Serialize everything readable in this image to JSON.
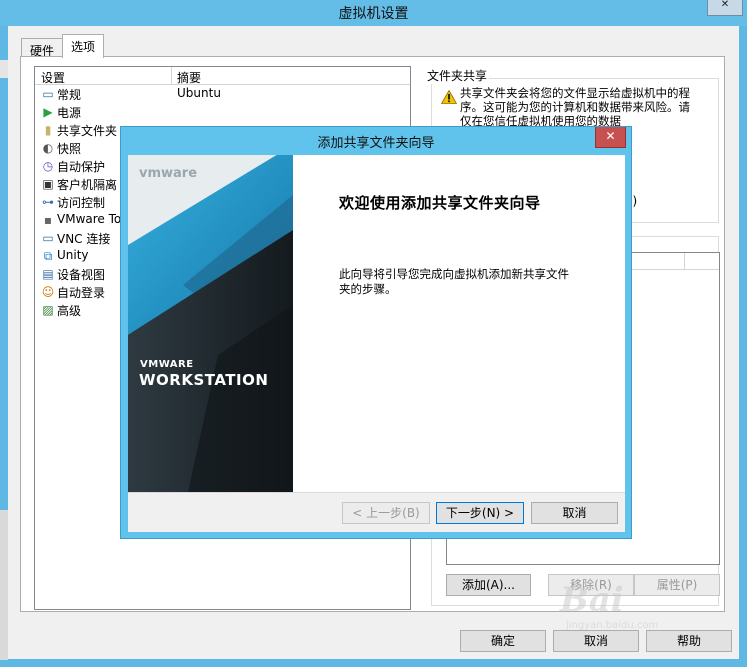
{
  "main_window": {
    "title": "虚拟机设置",
    "tabs": [
      {
        "label": "硬件",
        "selected": false
      },
      {
        "label": "选项",
        "selected": true
      }
    ],
    "settings_list": {
      "columns": [
        "设置",
        "摘要"
      ],
      "rows": [
        {
          "label": "常规",
          "summary": "Ubuntu",
          "icon": "monitor-icon"
        },
        {
          "label": "电源",
          "summary": "",
          "icon": "play-icon"
        },
        {
          "label": "共享文件夹",
          "summary": "",
          "icon": "folder-icon"
        },
        {
          "label": "快照",
          "summary": "",
          "icon": "snapshot-icon"
        },
        {
          "label": "自动保护",
          "summary": "",
          "icon": "clock-icon"
        },
        {
          "label": "客户机隔离",
          "summary": "",
          "icon": "lock-icon"
        },
        {
          "label": "访问控制",
          "summary": "",
          "icon": "link-icon"
        },
        {
          "label": "VMware To",
          "summary": "",
          "icon": "vm-icon"
        },
        {
          "label": "VNC 连接",
          "summary": "",
          "icon": "screen-icon"
        },
        {
          "label": "Unity",
          "summary": "",
          "icon": "unity-icon"
        },
        {
          "label": "设备视图",
          "summary": "",
          "icon": "device-icon"
        },
        {
          "label": "自动登录",
          "summary": "",
          "icon": "users-icon"
        },
        {
          "label": "高级",
          "summary": "",
          "icon": "chart-icon"
        }
      ]
    },
    "shared_folders": {
      "group_label": "文件夹共享",
      "warning_text": "共享文件夹会将您的文件显示给虚拟机中的程序。这可能为您的计算机和数据带来风险。请仅在您信任虚拟机使用您的数据",
      "partial_visible_text": "J)",
      "buttons": {
        "add": "添加(A)...",
        "remove": "移除(R)",
        "properties": "属性(P)"
      }
    },
    "buttons": {
      "ok": "确定",
      "cancel": "取消",
      "help": "帮助"
    }
  },
  "wizard": {
    "title": "添加共享文件夹向导",
    "banner": {
      "logo": "vmware",
      "product_top": "VMWARE",
      "product_name": "WORKSTATION",
      "accent": "#1d9fd6"
    },
    "heading": "欢迎使用添加共享文件夹向导",
    "description": "此向导将引导您完成向虚拟机添加新共享文件夹的步骤。",
    "buttons": {
      "back": "< 上一步(B)",
      "next": "下一步(N) >",
      "cancel": "取消"
    }
  },
  "watermark": {
    "text": "Bai",
    "subtext": "jingyan.baidu.com"
  },
  "colors": {
    "titlebar": "#63bde6",
    "wizard_close": "#c75050",
    "warning": "#f2c200"
  }
}
